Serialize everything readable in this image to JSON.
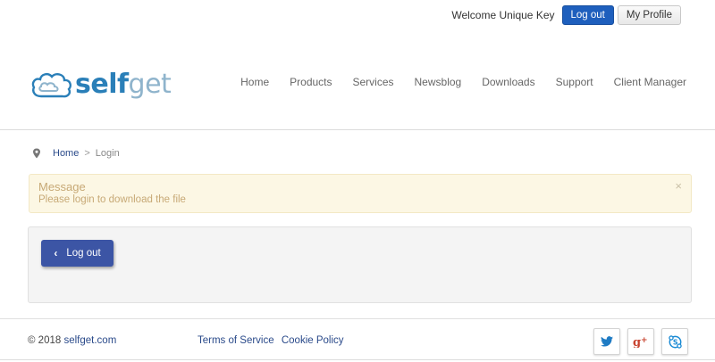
{
  "topbar": {
    "welcome": "Welcome Unique Key",
    "logout_label": "Log out",
    "profile_label": "My Profile"
  },
  "logo": {
    "self": "self",
    "get": "get",
    "brand_color": "#2a7fb8"
  },
  "nav": {
    "items": [
      {
        "label": "Home"
      },
      {
        "label": "Products"
      },
      {
        "label": "Services"
      },
      {
        "label": "Newsblog"
      },
      {
        "label": "Downloads"
      },
      {
        "label": "Support"
      },
      {
        "label": "Client Manager"
      }
    ]
  },
  "breadcrumb": {
    "icon": "map-pin-icon",
    "home": "Home",
    "separator": ">",
    "current": "Login"
  },
  "alert": {
    "title": "Message",
    "text": "Please login to download the file",
    "close": "×",
    "background": "#fcf7e4"
  },
  "panel": {
    "button_label": "Log out",
    "button_icon": "chevron-left-icon",
    "button_color": "#3c55a5"
  },
  "footer": {
    "copyright_prefix": "© 2018",
    "copyright_link": "selfget.com",
    "links": [
      {
        "label": "Terms of Service"
      },
      {
        "label": "Cookie Policy"
      }
    ],
    "social": [
      {
        "icon": "twitter-icon"
      },
      {
        "icon": "google-plus-icon"
      },
      {
        "icon": "skype-icon"
      }
    ]
  }
}
